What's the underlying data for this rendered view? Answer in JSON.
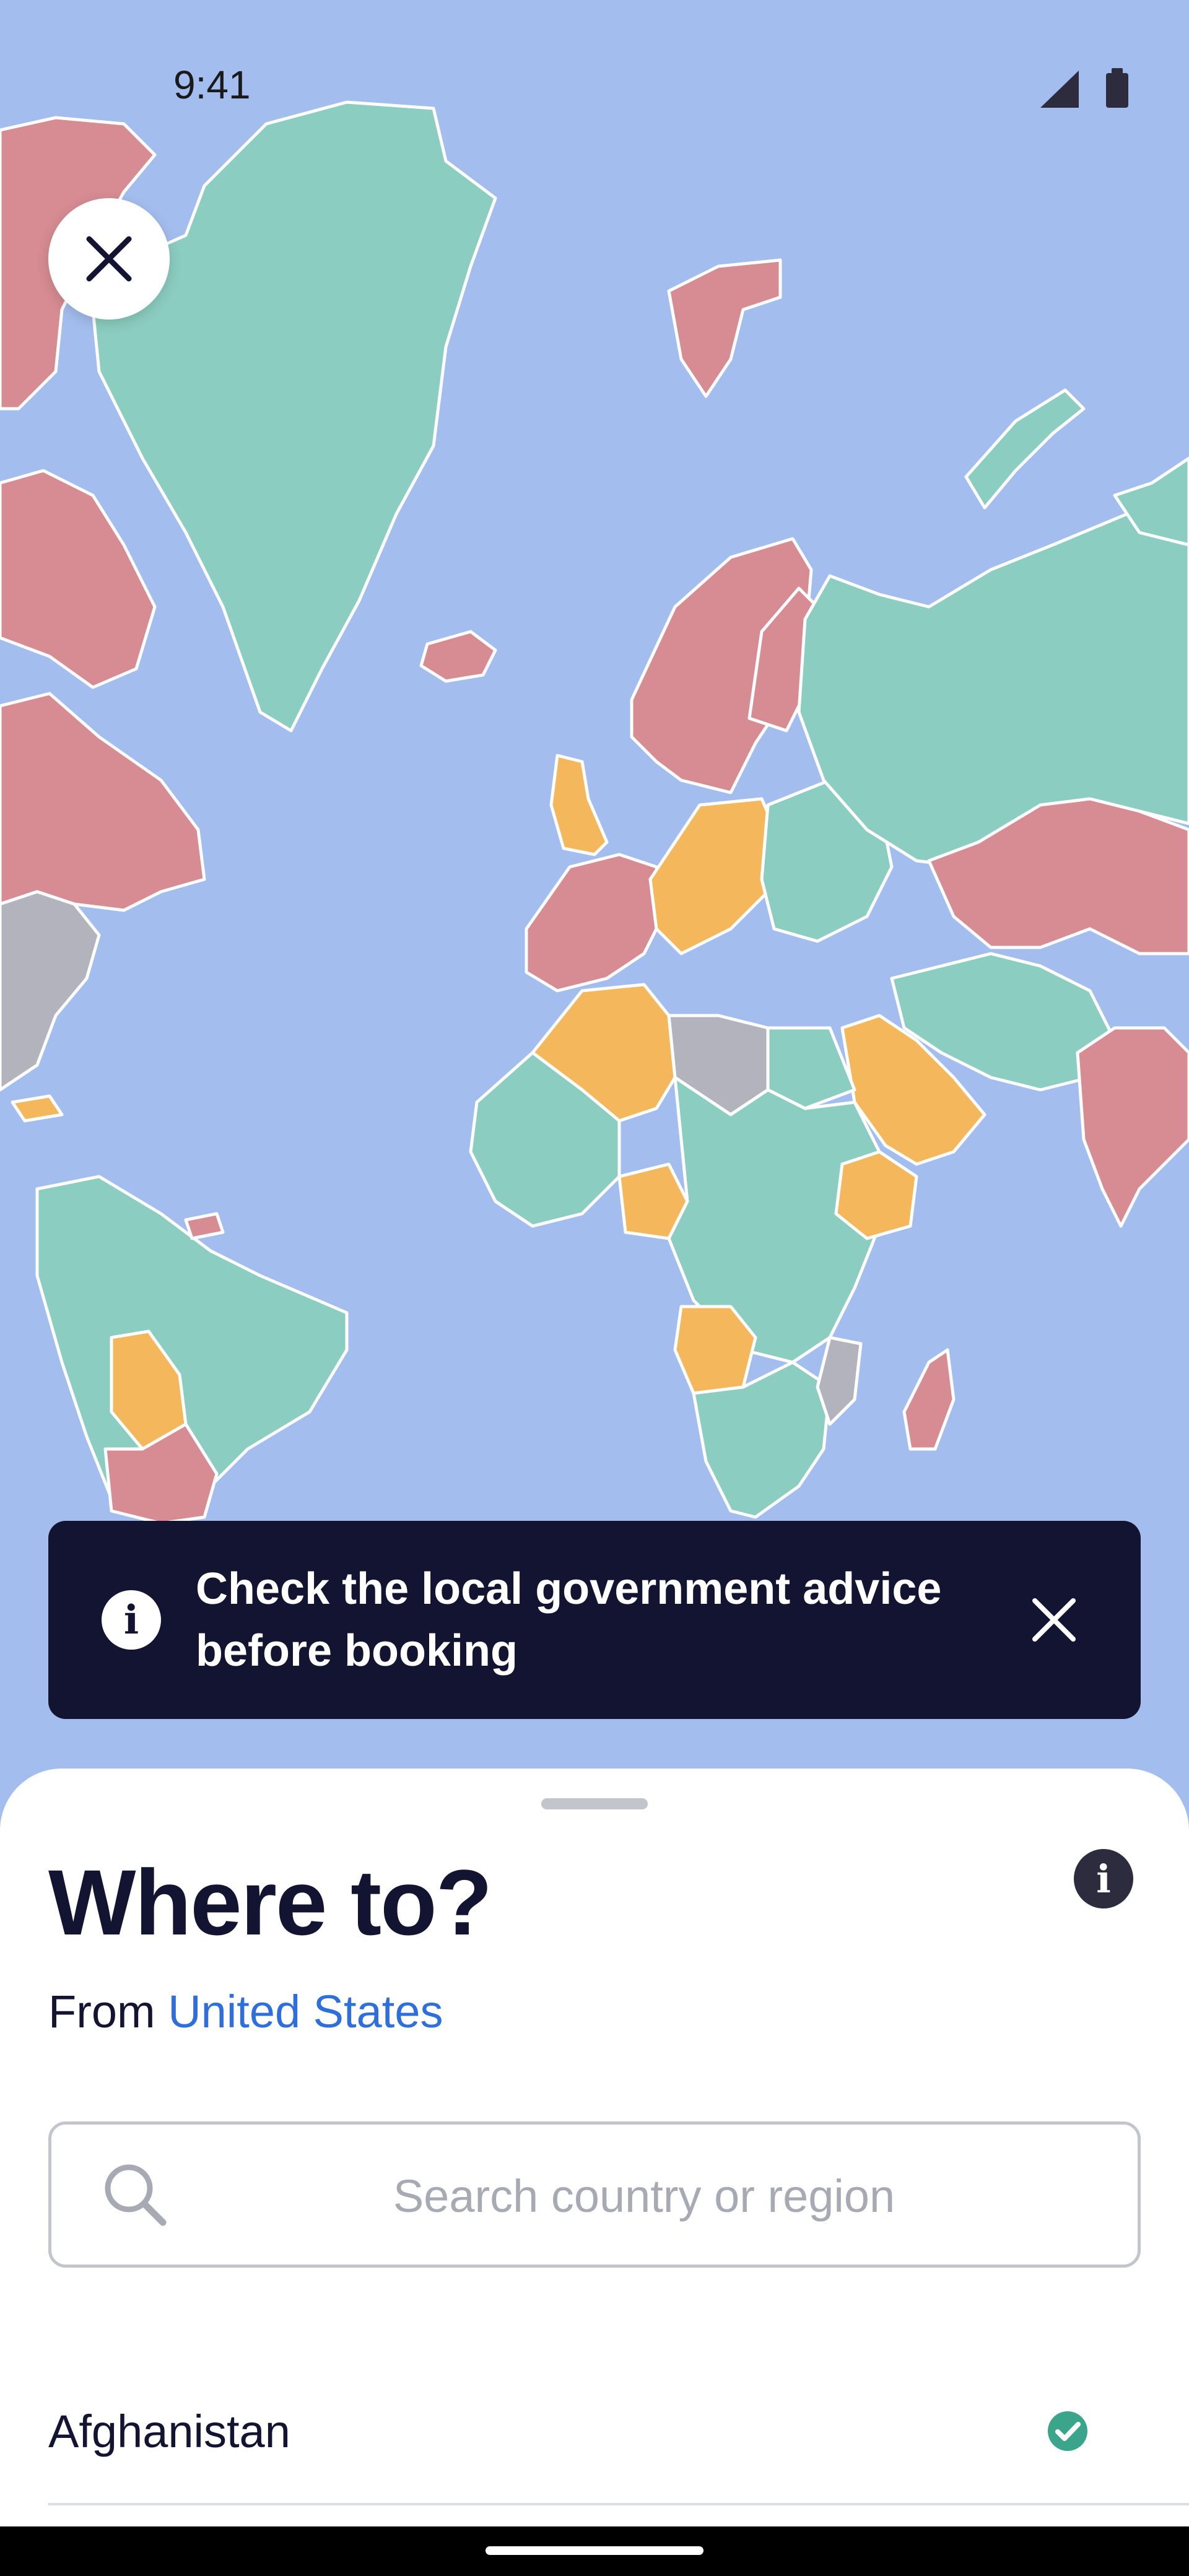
{
  "status_bar": {
    "time": "9:41",
    "icons": [
      "signal-icon",
      "battery-icon"
    ]
  },
  "map": {
    "colors": {
      "ocean": "#a3bdee",
      "open": "#8ccdc1",
      "restricted": "#f4b75c",
      "closed": "#d68c92",
      "unknown": "#b3b3bd",
      "border": "#ffffff"
    }
  },
  "banner": {
    "text": "Check the local government advice before booking",
    "icons": [
      "info-icon",
      "close-icon"
    ]
  },
  "sheet": {
    "title": "Where to?",
    "from_label": "From",
    "from_value": "United States",
    "search_placeholder": "Search country or region",
    "items": [
      {
        "label": "Afghanistan",
        "status_icon": "check-circle-icon",
        "status_color": "#3aa58a"
      }
    ]
  }
}
